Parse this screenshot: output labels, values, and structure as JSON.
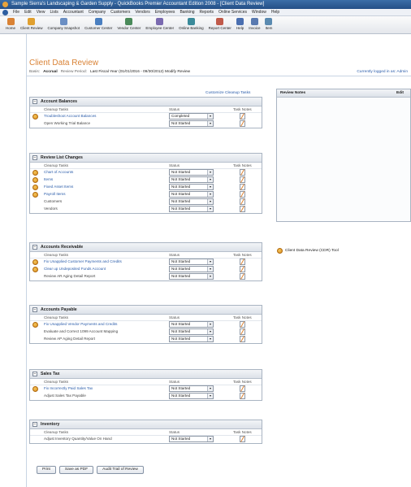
{
  "window": {
    "title": "Sample Sierra's Landscaping & Garden Supply - QuickBooks Premier Accountant Edition 2008 - [Client Data Review]"
  },
  "menu": [
    "File",
    "Edit",
    "View",
    "Lists",
    "Accountant",
    "Company",
    "Customers",
    "Vendors",
    "Employees",
    "Banking",
    "Reports",
    "Online Services",
    "Window",
    "Help"
  ],
  "toolbar": [
    {
      "label": "Home",
      "icon": "home-icon",
      "color": "#d98235"
    },
    {
      "label": "Client Review",
      "icon": "client-review-icon",
      "color": "#e0a030"
    },
    {
      "label": "Company Snapshot",
      "icon": "snapshot-icon",
      "color": "#6b8fc4"
    },
    {
      "label": "Customer Center",
      "icon": "customer-icon",
      "color": "#4a7fc0"
    },
    {
      "label": "Vendor Center",
      "icon": "vendor-icon",
      "color": "#4a8a5a"
    },
    {
      "label": "Employee Center",
      "icon": "employee-icon",
      "color": "#7a6ab0"
    },
    {
      "label": "Online Banking",
      "icon": "bank-icon",
      "color": "#3a8a9a"
    },
    {
      "label": "Report Center",
      "icon": "report-icon",
      "color": "#c05a4a"
    },
    {
      "label": "Help",
      "icon": "help-icon",
      "color": "#4a6fb0"
    },
    {
      "label": "Invoice",
      "icon": "invoice-icon",
      "color": "#5a7ab0"
    },
    {
      "label": "Item",
      "icon": "item-icon",
      "color": "#5a8ab0"
    }
  ],
  "page": {
    "title": "Client Data Review",
    "breadcrumb": {
      "prefix": "Basis:",
      "active": "Accrual",
      "link": "Review Period:",
      "period": "Last Fiscal Year (01/01/2016 - 09/30/2012) Modify Review"
    },
    "right_link": "Currently logged in as: Admin",
    "customize_link": "Customize Cleanup Tasks"
  },
  "columns": {
    "task": "Cleanup Tasks",
    "status": "Status",
    "notes": "Task Notes"
  },
  "sections": [
    {
      "title": "Account Balances",
      "rows": [
        {
          "task": "Troubleshoot Account Balances",
          "status": "Completed",
          "alert": true
        },
        {
          "task": "Open Working Trial Balance",
          "status": "Not Started",
          "alert": false
        }
      ]
    },
    {
      "title": "Review List Changes",
      "rows": [
        {
          "task": "Chart of Accounts",
          "status": "Not Started",
          "alert": true
        },
        {
          "task": "Items",
          "status": "Not Started",
          "alert": true
        },
        {
          "task": "Fixed Asset Items",
          "status": "Not Started",
          "alert": true
        },
        {
          "task": "Payroll Items",
          "status": "Not Started",
          "alert": true
        },
        {
          "task": "Customers",
          "status": "Not Started",
          "alert": false
        },
        {
          "task": "Vendors",
          "status": "Not Started",
          "alert": false
        }
      ]
    },
    {
      "title": "Accounts Receivable",
      "rows": [
        {
          "task": "Fix Unapplied Customer Payments and Credits",
          "status": "Not Started",
          "alert": true
        },
        {
          "task": "Clear up Undeposited Funds Account",
          "status": "Not Started",
          "alert": true
        },
        {
          "task": "Review AR Aging Detail Report",
          "status": "Not Started",
          "alert": false
        }
      ]
    },
    {
      "title": "Accounts Payable",
      "rows": [
        {
          "task": "Fix Unapplied Vendor Payments and Credits",
          "status": "Not Started",
          "alert": true
        },
        {
          "task": "Evaluate and Correct 1099 Account Mapping",
          "status": "Not Started",
          "alert": false
        },
        {
          "task": "Review AP Aging Detail Report",
          "status": "Not Started",
          "alert": false
        }
      ]
    },
    {
      "title": "Sales Tax",
      "rows": [
        {
          "task": "Fix Incorrectly Paid Sales Tax",
          "status": "Not Started",
          "alert": true
        },
        {
          "task": "Adjust Sales Tax Payable",
          "status": "Not Started",
          "alert": false
        }
      ]
    },
    {
      "title": "Inventory",
      "rows": [
        {
          "task": "Adjust Inventory Quantity/Value On Hand",
          "status": "Not Started",
          "alert": false
        }
      ]
    }
  ],
  "review_notes": {
    "header": "Review Notes",
    "edit": "Edit"
  },
  "cdr_link": "Client Data Review (CDR) Tool",
  "bottom_buttons": [
    "Print",
    "Save as PDF",
    "Audit Trail of Review"
  ]
}
